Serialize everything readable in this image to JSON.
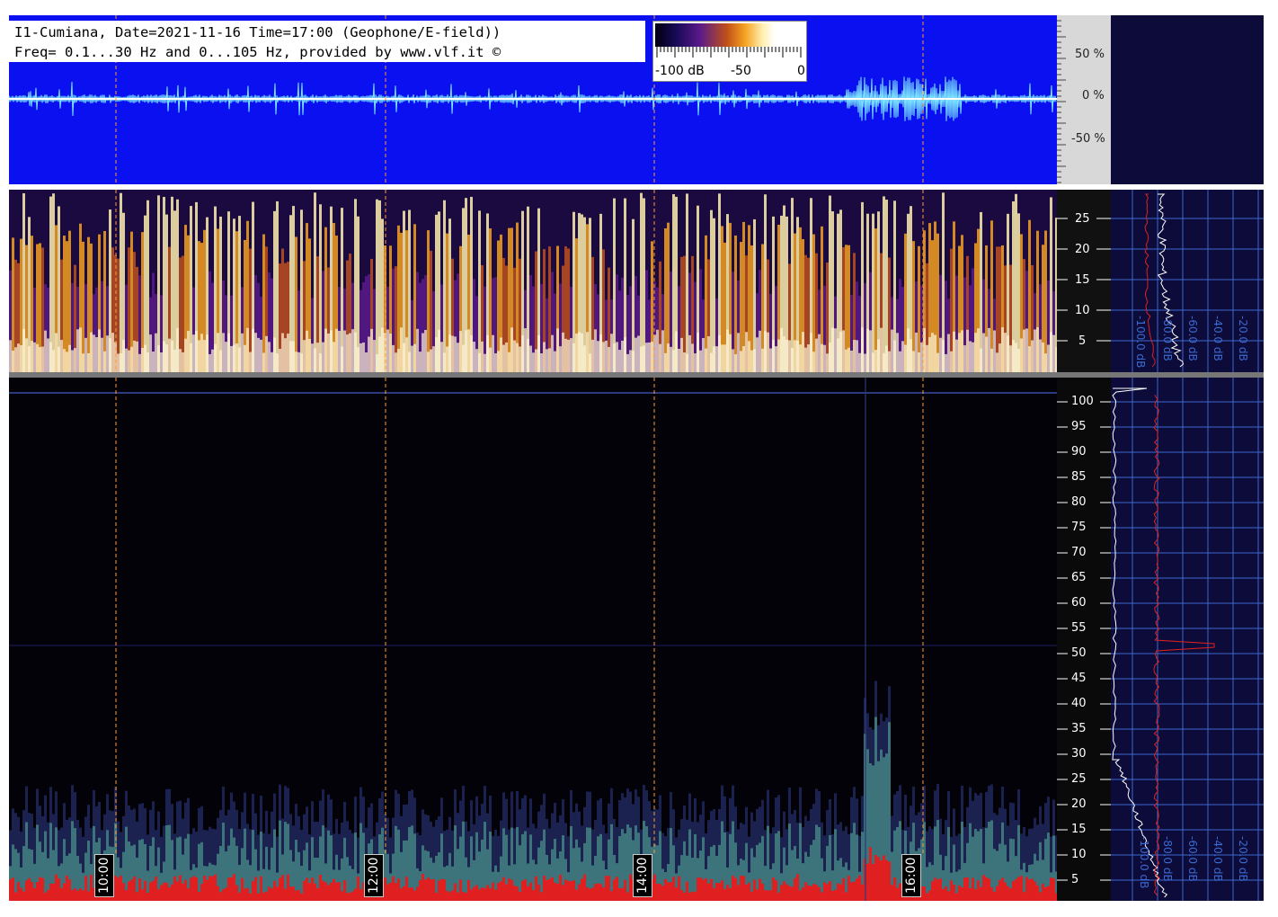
{
  "header": {
    "line1": "I1-Cumiana, Date=2021-11-16 Time=17:00 (Geophone/E-field))",
    "line2": "Freq= 0.1...30 Hz and 0...105 Hz, provided by www.vlf.it ©"
  },
  "colorbar": {
    "labels": [
      "-100 dB",
      "-50",
      "0"
    ]
  },
  "waveform_axis": {
    "labels": [
      "50 %",
      "0 %",
      "-50 %"
    ]
  },
  "spectrogram_low": {
    "freq_labels": [
      "25",
      "20",
      "15",
      "10",
      "5"
    ],
    "db_labels": [
      "-100.0 dB",
      "-80.0 dB",
      "-60.0 dB",
      "-40.0 dB",
      "-20.0 dB"
    ]
  },
  "spectrogram_high": {
    "freq_labels": [
      "100",
      "95",
      "90",
      "85",
      "80",
      "75",
      "70",
      "65",
      "60",
      "55",
      "50",
      "45",
      "40",
      "35",
      "30",
      "25",
      "20",
      "15",
      "10",
      "5"
    ],
    "db_labels": [
      "-100.0 dB",
      "-80.0 dB",
      "-60.0 dB",
      "-40.0 dB",
      "-20.0 dB"
    ]
  },
  "time_labels": [
    "10:00",
    "12:00",
    "14:00",
    "16:00"
  ],
  "colors": {
    "waveform_bg": "#0a10f0",
    "marker": "#ff9a3a",
    "trace_red": "#e02020",
    "trace_white": "#ffffff",
    "grid": "#3a6ad0"
  }
}
